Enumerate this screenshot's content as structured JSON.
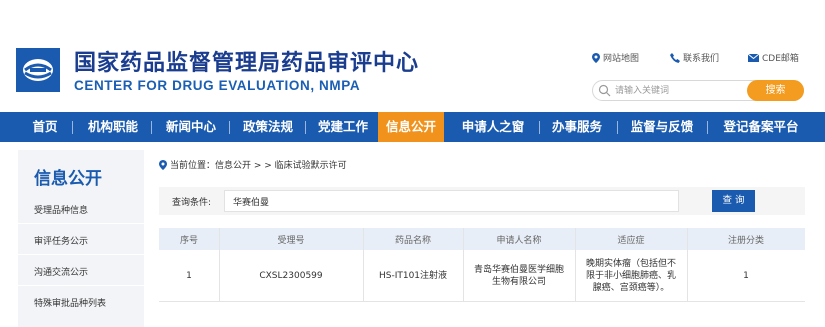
{
  "header": {
    "title_cn": "国家药品监督管理局药品审评中心",
    "title_en": "CENTER FOR DRUG EVALUATION, NMPA",
    "links": [
      "网站地图",
      "联系我们",
      "CDE邮箱"
    ],
    "search_placeholder": "请输入关键词",
    "search_button": "搜索"
  },
  "nav": {
    "items": [
      "首页",
      "机构职能",
      "新闻中心",
      "政策法规",
      "党建工作",
      "信息公开",
      "申请人之窗",
      "办事服务",
      "监督与反馈",
      "登记备案平台"
    ],
    "active": "信息公开"
  },
  "sidebar": {
    "title": "信息公开",
    "items": [
      "受理品种信息",
      "审评任务公示",
      "沟通交流公示",
      "特殊审批品种列表"
    ]
  },
  "breadcrumb": "当前位置：信息公开 > > 临床试验默示许可",
  "query": {
    "label": "查询条件:",
    "value": "华赛伯曼",
    "button": "查 询"
  },
  "table": {
    "columns": [
      "序号",
      "受理号",
      "药品名称",
      "申请人名称",
      "适应症",
      "注册分类"
    ],
    "rows": [
      {
        "index": "1",
        "acceptance_no": "CXSL2300599",
        "drug_name": "HS-IT101注射液",
        "applicant": "青岛华赛伯曼医学细胞生物有限公司",
        "indication": "晚期实体瘤（包括但不限于非小细胞肺癌、乳腺癌、宫颈癌等）。",
        "category": "1"
      }
    ]
  },
  "colors": {
    "nav_bg": "#1a5bb0",
    "accent": "#f0921c",
    "title": "#1a3d8f"
  }
}
